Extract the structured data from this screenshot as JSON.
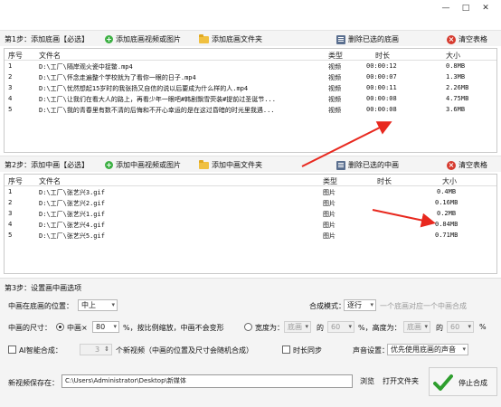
{
  "window": {
    "min": "—",
    "max": "□",
    "close": "✕"
  },
  "step1": {
    "title": "第1步：添加底画【必选】",
    "add_video_btn": "添加底画视频或图片",
    "add_folder_btn": "添加底画文件夹",
    "delete_btn": "删除已选的底画",
    "clear_btn": "清空表格",
    "headers": {
      "seq": "序号",
      "file": "文件名",
      "type": "类型",
      "duration": "时长",
      "size": "大小"
    },
    "rows": [
      {
        "seq": "1",
        "file": "D:\\工厂\\隔岸观火瓷中捉鳖.mp4",
        "type": "视频",
        "duration": "00:00:12",
        "size": "0.8MB"
      },
      {
        "seq": "2",
        "file": "D:\\工厂\\怀念走遍整个学校就为了看你一眼的日子.mp4",
        "type": "视频",
        "duration": "00:00:07",
        "size": "1.3MB"
      },
      {
        "seq": "3",
        "file": "D:\\工厂\\忧然想起15岁时的我张扬又自信的说以后要成为什么样的人.mp4",
        "type": "视频",
        "duration": "00:00:11",
        "size": "2.26MB"
      },
      {
        "seq": "4",
        "file": "D:\\工厂\\让我们在看大人的路上，再看少年一眼吧#韩剧飘雪荧装#提前过圣诞节...",
        "type": "视频",
        "duration": "00:00:08",
        "size": "4.75MB"
      },
      {
        "seq": "5",
        "file": "D:\\工厂\\我的青春里有数不清的后悔和不开心幸运的是在这过昏暗的时光里我遇...",
        "type": "视频",
        "duration": "00:00:08",
        "size": "3.6MB"
      }
    ]
  },
  "step2": {
    "title": "第2步：添加中画【必选】",
    "add_video_btn": "添加中画视频或图片",
    "add_folder_btn": "添加中画文件夹",
    "delete_btn": "删除已选的中画",
    "clear_btn": "清空表格",
    "headers": {
      "seq": "序号",
      "file": "文件名",
      "type": "类型",
      "duration": "时长",
      "size": "大小"
    },
    "rows": [
      {
        "seq": "1",
        "file": "D:\\工厂\\张艺兴3.gif",
        "type": "图片",
        "duration": "",
        "size": "0.4MB"
      },
      {
        "seq": "2",
        "file": "D:\\工厂\\张艺兴2.gif",
        "type": "图片",
        "duration": "",
        "size": "0.16MB"
      },
      {
        "seq": "3",
        "file": "D:\\工厂\\张艺兴1.gif",
        "type": "图片",
        "duration": "",
        "size": "0.2MB"
      },
      {
        "seq": "4",
        "file": "D:\\工厂\\张艺兴4.gif",
        "type": "图片",
        "duration": "",
        "size": "0.84MB"
      },
      {
        "seq": "5",
        "file": "D:\\工厂\\张艺兴5.gif",
        "type": "图片",
        "duration": "",
        "size": "0.71MB"
      }
    ]
  },
  "step3": {
    "title": "第3步：设置画中画选项",
    "position_label": "中画在底画的位置：",
    "position_value": "中上",
    "blend_label": "合成模式：",
    "blend_value": "逐行",
    "blend_hint": "一个底画对应一个中画合成",
    "size_label": "中画的尺寸：",
    "size_radio": "中画×",
    "size_value": "80",
    "size_suffix": "%，按比例缩放，中画不会变形",
    "wh_radio": "宽度为：",
    "wh_sel1": "底画",
    "wh_of1": "的",
    "wh_pct1": "60",
    "wh_mid": "%，高度为：",
    "wh_sel2": "底画",
    "wh_of2": "的",
    "wh_pct2": "60",
    "wh_end": "%",
    "ai_label": "AI智能合成：",
    "ai_count": "3",
    "ai_suffix": "个新视频（中画的位置及尺寸会随机合成）",
    "sync_label": "时长同步",
    "audio_label": "声音设置：",
    "audio_value": "优先使用底画的声音"
  },
  "save": {
    "label": "新视频保存在：",
    "path": "C:\\Users\\Administrator\\Desktop\\新媒体",
    "browse": "浏览",
    "open_folder": "打开文件夹",
    "stop": "停止合成"
  }
}
